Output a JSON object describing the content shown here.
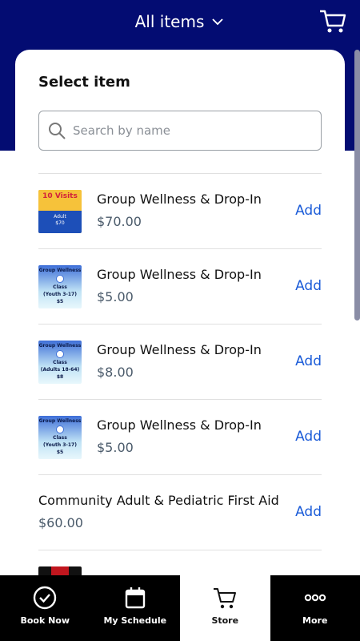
{
  "header": {
    "title": "All items"
  },
  "card": {
    "title": "Select item"
  },
  "search": {
    "placeholder": "Search by name"
  },
  "items": [
    {
      "name": "Group Wellness & Drop-In",
      "price": "$70.00",
      "add": "Add",
      "thumb": {
        "line1": "10 Visits",
        "line2": "Adult",
        "line3": "$70"
      }
    },
    {
      "name": "Group Wellness & Drop-In",
      "price": "$5.00",
      "add": "Add",
      "thumb": {
        "line1": "Group Wellness",
        "line2": "Class",
        "line3": "(Youth 3-17)",
        "line4": "$5"
      }
    },
    {
      "name": "Group Wellness & Drop-In",
      "price": "$8.00",
      "add": "Add",
      "thumb": {
        "line1": "Group Wellness",
        "line2": "Class",
        "line3": "(Adults 18-64)",
        "line4": "$8"
      }
    },
    {
      "name": "Group Wellness & Drop-In",
      "price": "$5.00",
      "add": "Add",
      "thumb": {
        "line1": "Group Wellness",
        "line2": "Class",
        "line3": "(Youth 3-17)",
        "line4": "$5"
      }
    },
    {
      "name": "Community Adult & Pediatric First Aid",
      "price": "$60.00",
      "add": "Add"
    }
  ],
  "tabs": [
    {
      "label": "Book Now",
      "icon": "check-circle-icon"
    },
    {
      "label": "My Schedule",
      "icon": "calendar-icon"
    },
    {
      "label": "Store",
      "icon": "cart-icon",
      "active": true
    },
    {
      "label": "More",
      "icon": "more-icon"
    }
  ],
  "colors": {
    "header": "#030c72",
    "accent": "#1a5bd8",
    "tabbar": "#000000"
  }
}
